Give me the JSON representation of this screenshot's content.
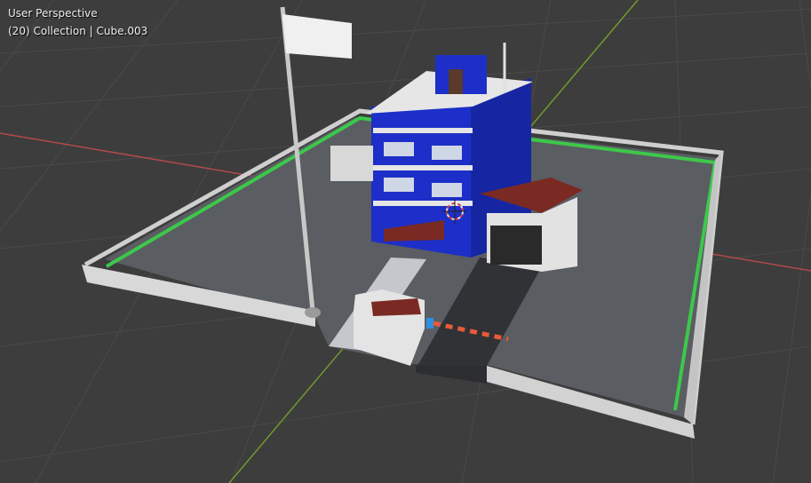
{
  "viewport": {
    "view_label": "User Perspective",
    "frame_number": "(20)",
    "collection": "Collection",
    "separator": "|",
    "active_object": "Cube.003"
  },
  "scene": {
    "icons": [
      "flagpole",
      "police-station-building",
      "guard-booth",
      "barrier-gate",
      "garage",
      "perimeter-wall",
      "3d-cursor-icon"
    ],
    "colors": {
      "background": "#3d3d3d",
      "grid": "#4a4a4a",
      "x_axis": "#b34a4a",
      "y_axis": "#6f9a2a",
      "building_blue": "#1d2fc8",
      "wall": "#d8d8d8",
      "ground": "#5a5d62",
      "grass_strip": "#3cc84a",
      "roof_red": "#7a2a22"
    }
  }
}
